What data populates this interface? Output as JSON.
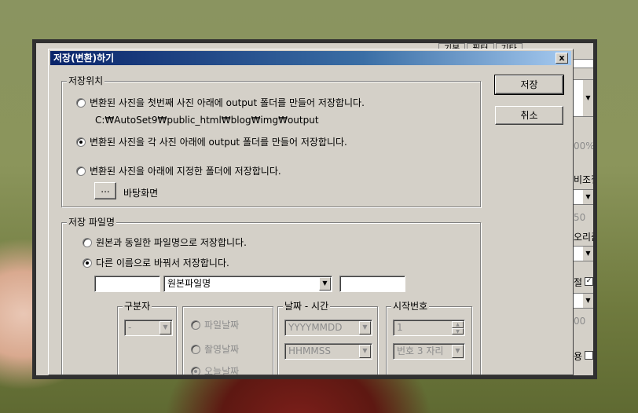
{
  "dialog": {
    "title": "저장(변환)하기",
    "close_label": "x",
    "save_button": "저장",
    "cancel_button": "취소"
  },
  "save_location": {
    "group_title": "저장위치",
    "option_first_photo": "변환된 사진을 첫번째 사진 아래에 output 폴더를 만들어 저장합니다.",
    "first_photo_path": "C:₩AutoSet9₩public_html₩blog₩img₩output",
    "option_each_photo": "변환된 사진을 각 사진 아래에 output 폴더를 만들어 저장합니다.",
    "option_specified_folder": "변환된 사진을 아래에 지정한 폴더에 저장합니다.",
    "browse_button": "...",
    "folder_name": "바탕화면",
    "selected": "each_photo"
  },
  "file_name": {
    "group_title": "저장 파일명",
    "option_same_name": "원본과 동일한 파일명으로 저장합니다.",
    "option_different_name": "다른 이름으로 바꿔서 저장합니다.",
    "selected": "different_name",
    "prefix_value": "",
    "name_combo_value": "원본파일명",
    "suffix_value": "",
    "separator": {
      "title": "구분자",
      "value": "-"
    },
    "date_source": {
      "option_file_date": "파일날짜",
      "option_shoot_date": "촬영날짜",
      "option_today": "오늘날짜",
      "selected": "today"
    },
    "date_time": {
      "title": "날짜 - 시간",
      "date_format": "YYYYMMDD",
      "time_format": "HHMMSS"
    },
    "start_number": {
      "title": "시작번호",
      "value": "1",
      "digits": "번호 3 자리"
    }
  },
  "background_window": {
    "tabs": [
      "기본",
      "필터",
      "기타"
    ],
    "side_labels": [
      "00%",
      "비조절",
      "50",
      "오리즘",
      "절",
      "00",
      "용"
    ]
  }
}
